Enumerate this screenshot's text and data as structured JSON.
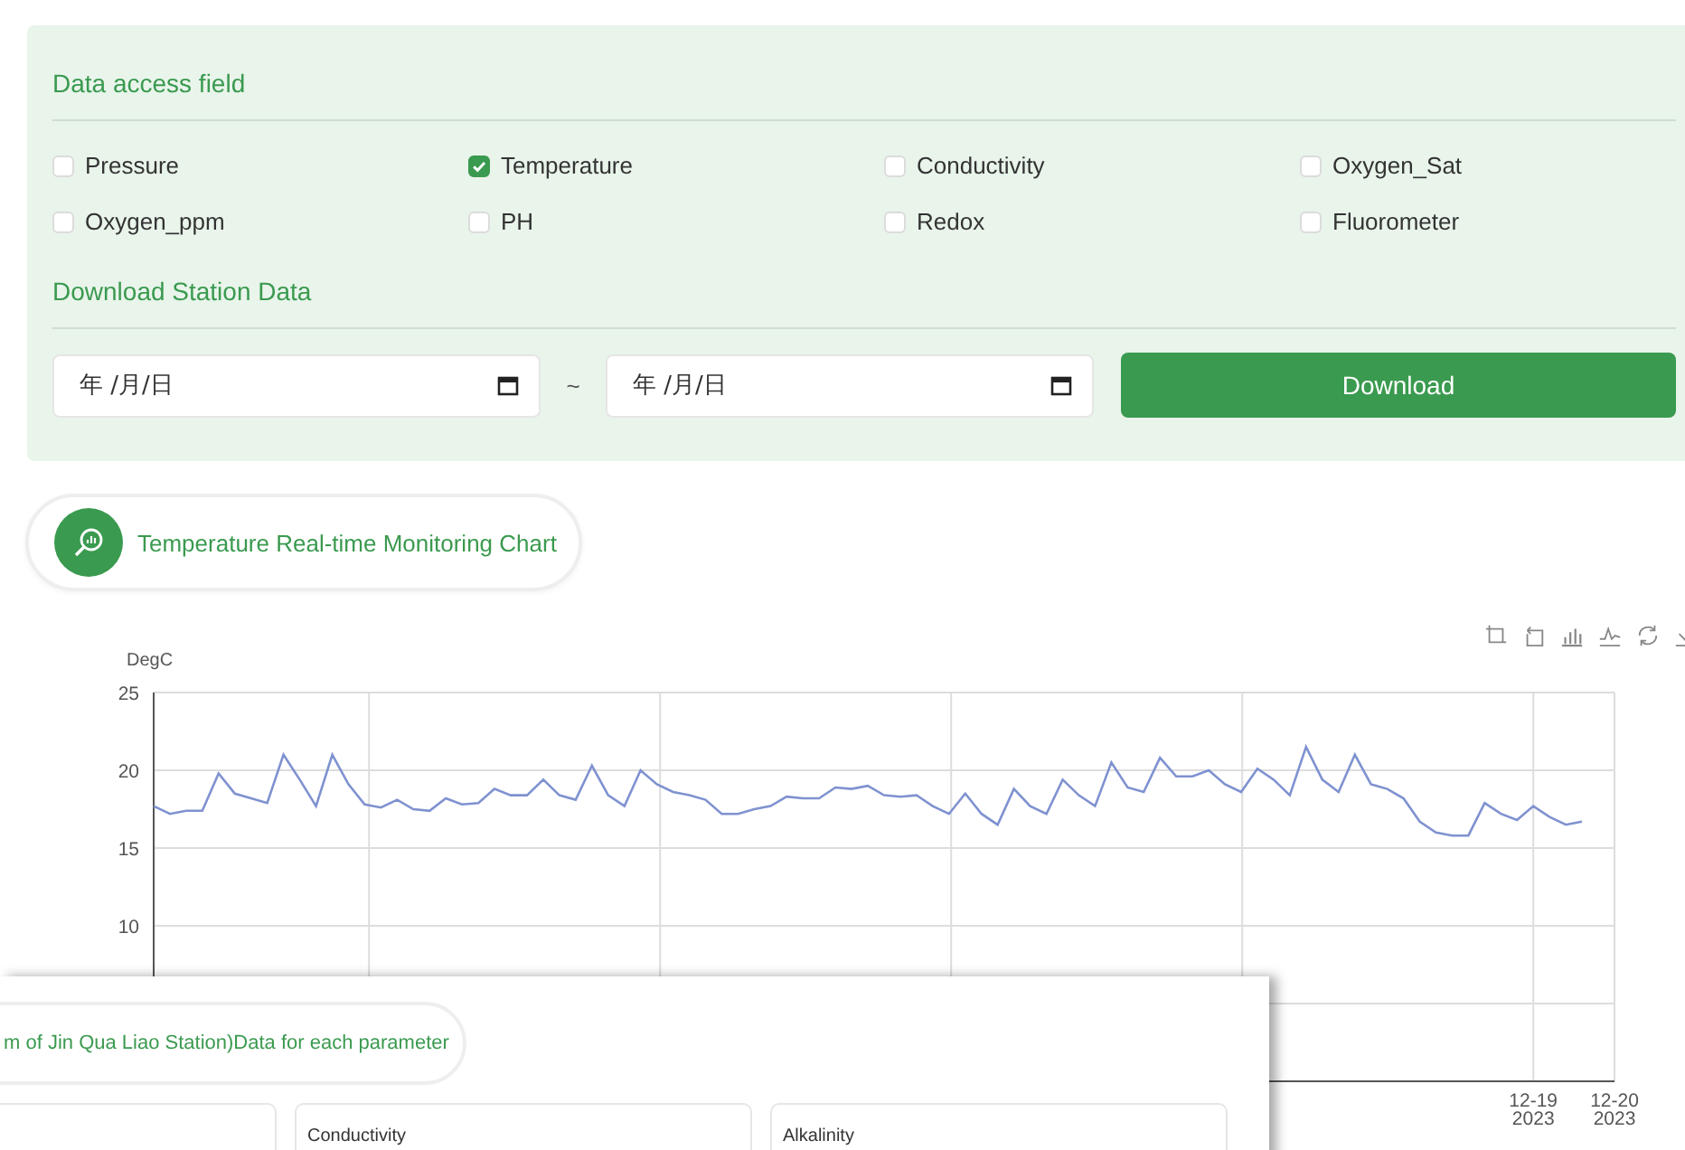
{
  "data_access": {
    "title": "Data access field",
    "checkboxes": [
      {
        "label": "Pressure",
        "checked": false
      },
      {
        "label": "Temperature",
        "checked": true
      },
      {
        "label": "Conductivity",
        "checked": false
      },
      {
        "label": "Oxygen_Sat",
        "checked": false
      },
      {
        "label": "Oxygen_ppm",
        "checked": false
      },
      {
        "label": "PH",
        "checked": false
      },
      {
        "label": "Redox",
        "checked": false
      },
      {
        "label": "Fluorometer",
        "checked": false
      }
    ]
  },
  "download": {
    "title": "Download Station Data",
    "start_date": {
      "placeholder": "年 /月/日"
    },
    "separator": "~",
    "end_date": {
      "placeholder": "年 /月/日"
    },
    "button": "Download"
  },
  "chart_panel": {
    "title": "Temperature Real-time Monitoring Chart",
    "chart_data": {
      "type": "line",
      "grid": true,
      "ylabel": "DegC",
      "ylim": [
        0,
        25
      ],
      "yticks": [
        10,
        15,
        20,
        25
      ],
      "categories": [
        null,
        null,
        null,
        null,
        null,
        null,
        null,
        null,
        null,
        null,
        null,
        null,
        null,
        null,
        null,
        null,
        null,
        null,
        null,
        null,
        null,
        null,
        null,
        null,
        null,
        null,
        null,
        null,
        null,
        null,
        null,
        null,
        null,
        null,
        null,
        null,
        null,
        null,
        null,
        null,
        null,
        null,
        null,
        null,
        null,
        null,
        null,
        null,
        null,
        null,
        null,
        null,
        null,
        null,
        null,
        null,
        null,
        null,
        null,
        null,
        null,
        null,
        null,
        null,
        null,
        null,
        null,
        null,
        null,
        null,
        null,
        null,
        null,
        null,
        null,
        null,
        null,
        null,
        null,
        null,
        null,
        null,
        null,
        null,
        null,
        "12-19 2023",
        null,
        null,
        null,
        null,
        "12-20 2023"
      ],
      "series": [
        {
          "color": "#7f92d0",
          "values": [
            17.7,
            17.2,
            17.4,
            17.4,
            19.8,
            18.5,
            18.2,
            17.9,
            21.0,
            19.4,
            17.7,
            21.0,
            19.1,
            17.8,
            17.6,
            18.1,
            17.5,
            17.4,
            18.2,
            17.8,
            17.9,
            18.8,
            18.4,
            18.4,
            19.4,
            18.4,
            18.1,
            20.3,
            18.4,
            17.7,
            20.0,
            19.1,
            18.6,
            18.4,
            18.1,
            17.2,
            17.2,
            17.5,
            17.7,
            18.3,
            18.2,
            18.2,
            18.9,
            18.8,
            19.0,
            18.4,
            18.3,
            18.4,
            17.7,
            17.2,
            18.5,
            17.2,
            16.5,
            18.8,
            17.7,
            17.2,
            19.4,
            18.4,
            17.7,
            20.5,
            18.9,
            18.6,
            20.8,
            19.6,
            19.6,
            20.0,
            19.1,
            18.6,
            20.1,
            19.4,
            18.4,
            21.5,
            19.4,
            18.6,
            21.0,
            19.1,
            18.8,
            18.2,
            16.7,
            16.0,
            15.8,
            15.8,
            17.9,
            17.2,
            16.8,
            17.7,
            17.0,
            16.5,
            16.7,
            null,
            null
          ]
        }
      ]
    }
  },
  "overlay_window": {
    "title": "m of Jin Qua Liao Station)Data for each parameter",
    "cards": [
      {
        "kind": "untitled"
      },
      {
        "kind": "titled",
        "title": "Conductivity"
      },
      {
        "kind": "titled",
        "title": "Alkalinity"
      }
    ]
  }
}
